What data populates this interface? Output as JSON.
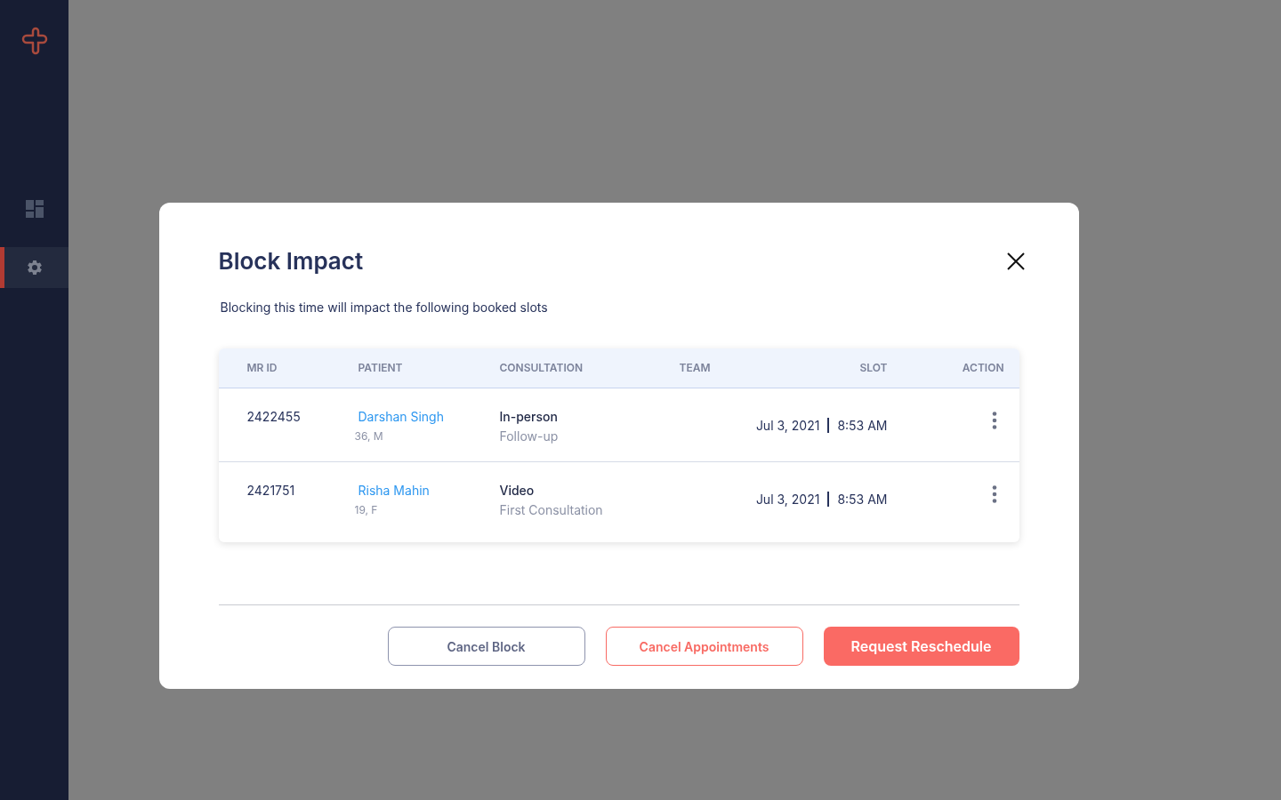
{
  "sidebar": {
    "items": [
      {
        "kind": "dashboard",
        "selected": false
      },
      {
        "kind": "settings",
        "selected": true
      }
    ]
  },
  "dialog": {
    "title": "Block Impact",
    "subtitle": "Blocking this time will impact the following booked slots",
    "table": {
      "columns": [
        "MR ID",
        "PATIENT",
        "CONSULTATION",
        "TEAM",
        "SLOT",
        "ACTION"
      ],
      "rows": [
        {
          "mr_id": "2422455",
          "patient": "Darshan Singh",
          "patient_info": "36, M",
          "consultation": "In-person",
          "consultation_type": "Follow-up",
          "slot_date": "Jul 3, 2021",
          "slot_time": "8:53 AM"
        },
        {
          "mr_id": "2421751",
          "patient": "Risha Mahin",
          "patient_info": "19, F",
          "consultation": "Video",
          "consultation_type": "First Consultation",
          "slot_date": "Jul 3, 2021",
          "slot_time": "8:53 AM"
        }
      ]
    },
    "buttons": [
      {
        "label": "Cancel Block",
        "kind": "neutral"
      },
      {
        "label": "Cancel Appointments",
        "kind": "danger-outline"
      },
      {
        "label": "Request Reschedule",
        "kind": "primary"
      }
    ]
  }
}
